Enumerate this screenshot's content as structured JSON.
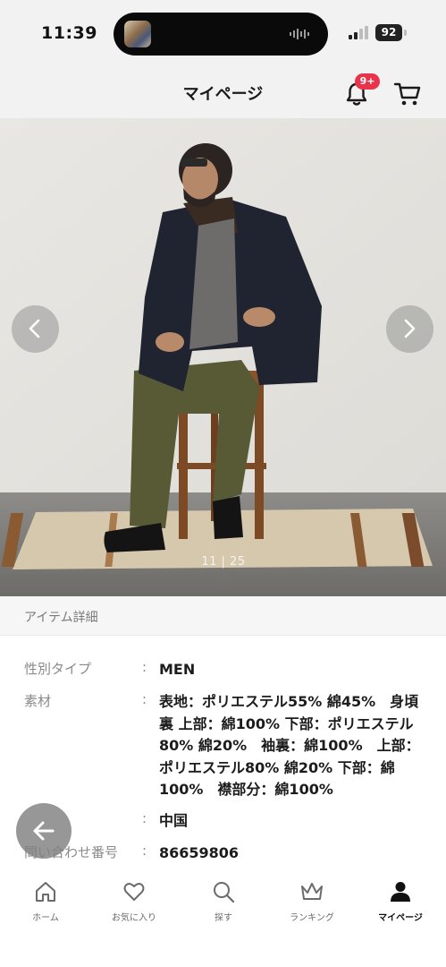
{
  "status_bar": {
    "time": "11:39",
    "battery": "92"
  },
  "header": {
    "title": "マイページ",
    "notification_badge": "9+"
  },
  "gallery": {
    "counter": "11 | 25"
  },
  "section": {
    "title": "アイテム詳細"
  },
  "details": [
    {
      "label": "性別タイプ",
      "colon": ":",
      "value": "MEN"
    },
    {
      "label": "素材",
      "colon": ":",
      "value": "表地：ポリエステル55% 綿45%　身頃裏 上部：綿100% 下部：ポリエステル80% 綿20%　袖裏：綿100%　上部：ポリエステル80% 綿20% 下部：綿100%　襟部分：綿100%"
    },
    {
      "label": "",
      "colon": ":",
      "value": "中国"
    },
    {
      "label": "問い合わせ番号",
      "colon": ":",
      "value": "86659806"
    }
  ],
  "tabs": [
    {
      "label": "ホーム",
      "icon": "home-icon"
    },
    {
      "label": "お気に入り",
      "icon": "heart-icon"
    },
    {
      "label": "探す",
      "icon": "search-icon"
    },
    {
      "label": "ランキング",
      "icon": "crown-icon"
    },
    {
      "label": "マイページ",
      "icon": "person-icon"
    }
  ],
  "colors": {
    "badge": "#e8334a",
    "header_bg": "#f2f2f2",
    "active_tab": "#111111"
  }
}
